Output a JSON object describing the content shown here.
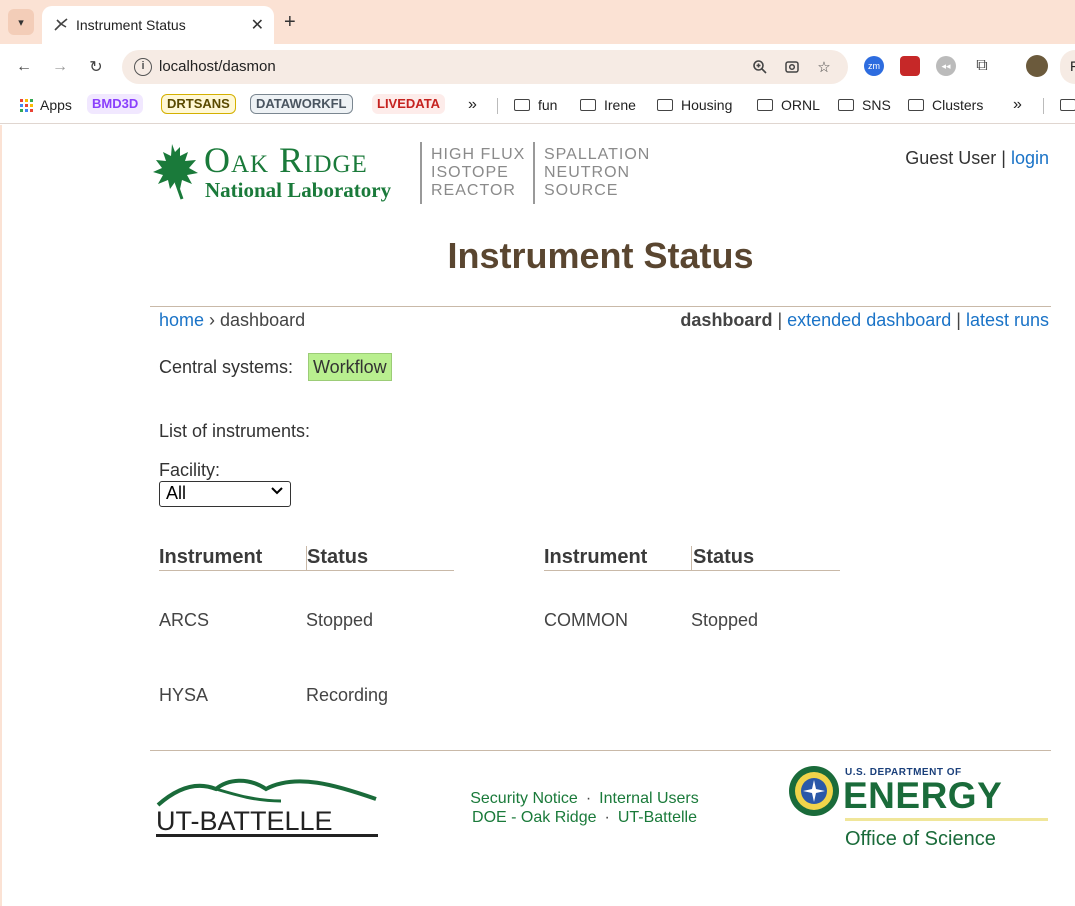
{
  "browser": {
    "tab_title": "Instrument Status",
    "url": "localhost/dasmon",
    "profile_initial": "F",
    "bookmarks": {
      "apps": "Apps",
      "chips": [
        {
          "label": "BMD3D",
          "color": "#8a3ffc",
          "bg": "#f1e8ff"
        },
        {
          "label": "DRTSANS",
          "color": "#5a4a00",
          "bg": "#fff8d6"
        },
        {
          "label": "DATAWORKFL",
          "color": "#4a5560",
          "bg": "#eef2f5"
        },
        {
          "label": "LIVEDATA",
          "color": "#c5221f",
          "bg": "#fdecea"
        }
      ],
      "folders": [
        "fun",
        "Irene",
        "Housing",
        "ORNL",
        "SNS",
        "Clusters"
      ]
    }
  },
  "header": {
    "ornl_line1": "Oak Ridge",
    "ornl_line2": "National Laboratory",
    "hfir": "HIGH FLUX\nISOTOPE\nREACTOR",
    "sns": "SPALLATION\nNEUTRON\nSOURCE",
    "user": "Guest User",
    "login": "login"
  },
  "page": {
    "title": "Instrument Status",
    "breadcrumb_home": "home",
    "breadcrumb_sep": " › ",
    "breadcrumb_current": "dashboard",
    "views": {
      "current": "dashboard",
      "extended": "extended dashboard",
      "latest": "latest runs"
    },
    "central_label": "Central systems:",
    "workflow": "Workflow",
    "list_label": "List of instruments:",
    "facility_label": "Facility:",
    "facility_selected": "All",
    "col_instrument": "Instrument",
    "col_status": "Status",
    "instruments": [
      {
        "name": "ARCS",
        "status": "Stopped"
      },
      {
        "name": "COMMON",
        "status": "Stopped"
      },
      {
        "name": "HYSA",
        "status": "Recording"
      }
    ]
  },
  "footer": {
    "security": "Security Notice",
    "internal": "Internal Users",
    "doe_ornl": "DOE - Oak Ridge",
    "utb": "UT-Battelle",
    "utb_logo_text": "UT-BATTELLE",
    "doe_small": "U.S. DEPARTMENT OF",
    "doe_big": "ENERGY",
    "doe_office": "Office of Science"
  }
}
